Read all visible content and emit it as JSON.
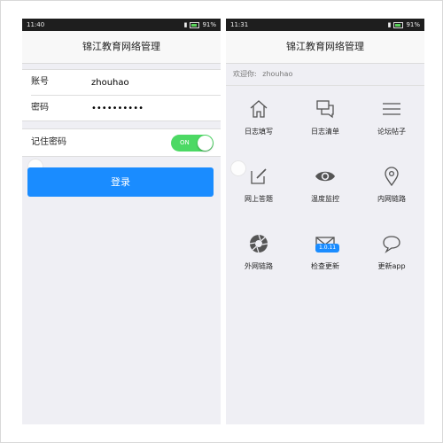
{
  "left_phone": {
    "status": {
      "time": "11:40",
      "battery": "91%"
    },
    "title": "锦江教育网络管理",
    "form": {
      "account_label": "账号",
      "account_value": "zhouhao",
      "password_label": "密码",
      "password_value": "••••••••••"
    },
    "remember": {
      "label": "记住密码",
      "toggle_text": "ON"
    },
    "login_button": "登录"
  },
  "right_phone": {
    "status": {
      "time": "11:31",
      "battery": "91%"
    },
    "title": "锦江教育网络管理",
    "welcome": {
      "prefix": "欢迎你:",
      "user": "zhouhao"
    },
    "menu": [
      {
        "label": "日志填写",
        "icon": "home-icon"
      },
      {
        "label": "日志清单",
        "icon": "chat-bubbles-icon"
      },
      {
        "label": "论坛帖子",
        "icon": "menu-lines-icon"
      },
      {
        "label": "网上答题",
        "icon": "edit-icon"
      },
      {
        "label": "温度监控",
        "icon": "eye-icon"
      },
      {
        "label": "内网链路",
        "icon": "location-pin-icon"
      },
      {
        "label": "外网链路",
        "icon": "aperture-icon"
      },
      {
        "label": "检查更新",
        "icon": "mail-icon",
        "badge": "1.0.11"
      },
      {
        "label": "更新app",
        "icon": "speech-bubble-icon"
      }
    ]
  }
}
